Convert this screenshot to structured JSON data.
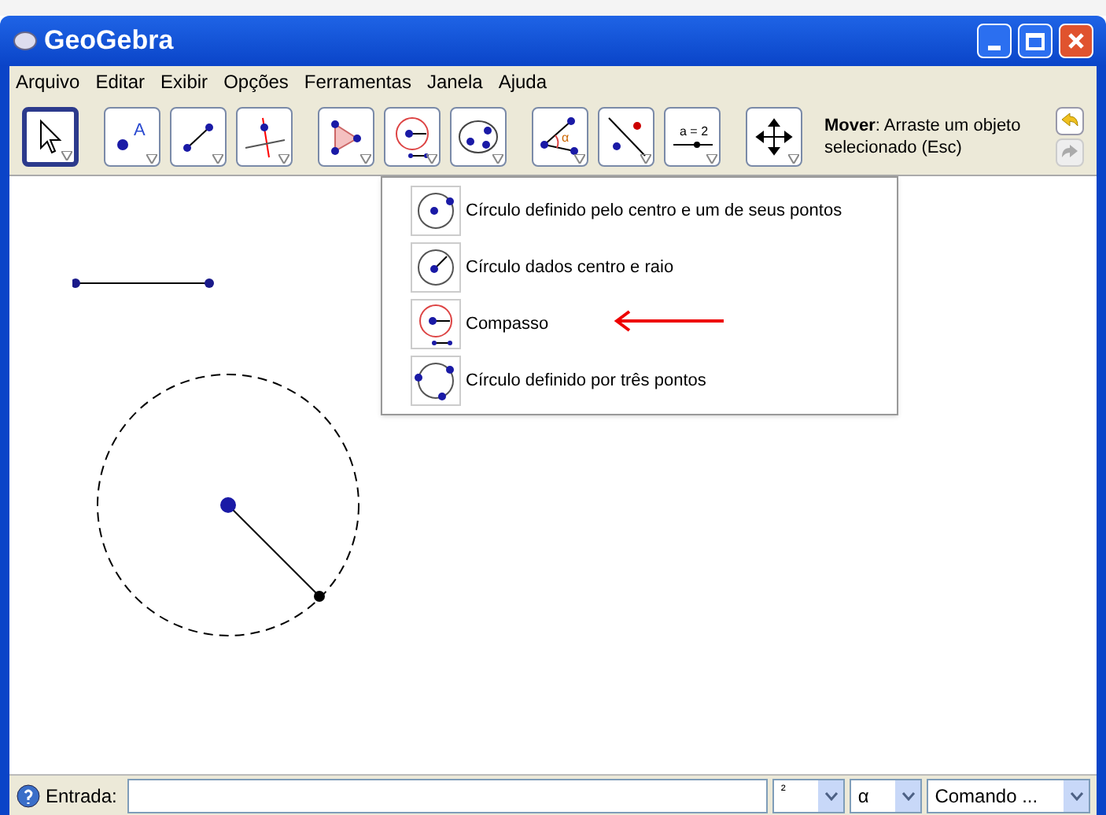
{
  "window": {
    "title": "GeoGebra"
  },
  "menu": [
    "Arquivo",
    "Editar",
    "Exibir",
    "Opções",
    "Ferramentas",
    "Janela",
    "Ajuda"
  ],
  "toolbar": {
    "tools": [
      {
        "kind": "move",
        "selected": true
      },
      {
        "kind": "point",
        "selected": false,
        "icon_text": "A"
      },
      {
        "kind": "segment",
        "selected": false
      },
      {
        "kind": "perpendicular",
        "selected": false
      },
      {
        "kind": "polygon",
        "selected": false
      },
      {
        "kind": "compass",
        "selected": false
      },
      {
        "kind": "conic",
        "selected": false
      },
      {
        "kind": "angle",
        "selected": false,
        "icon_text": "α"
      },
      {
        "kind": "reflect",
        "selected": false
      },
      {
        "kind": "slider",
        "selected": false,
        "icon_text": "a = 2"
      },
      {
        "kind": "pan",
        "selected": false
      }
    ],
    "help": "**Mover**: Arraste um objeto selecionado (Esc)"
  },
  "tool_menu": {
    "items": [
      {
        "kind": "circle-point",
        "label": "Círculo definido pelo centro e um de seus pontos"
      },
      {
        "kind": "circle-radius",
        "label": "Círculo dados centro e raio"
      },
      {
        "kind": "compass",
        "label": "Compasso"
      },
      {
        "kind": "circle-three",
        "label": "Círculo definido por três pontos"
      }
    ]
  },
  "input_bar": {
    "label": "Entrada:",
    "selects": [
      "²",
      "α",
      "Comando ..."
    ]
  }
}
